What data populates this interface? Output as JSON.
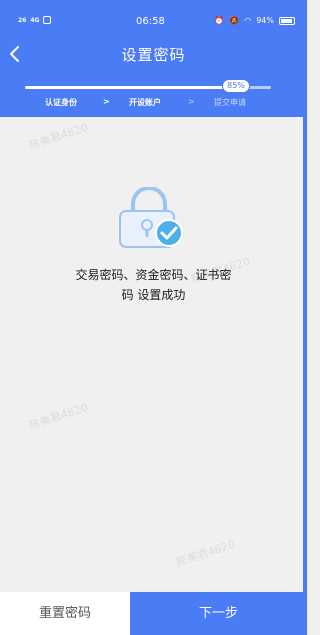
{
  "status_bar": {
    "signal_1": "26",
    "signal_2": "4G",
    "time": "06:58",
    "battery": "94%"
  },
  "nav": {
    "title": "设置密码"
  },
  "progress": {
    "value": 0.85,
    "label": "85%"
  },
  "steps": [
    {
      "label": "认证身份",
      "state": "done"
    },
    {
      "label": "开设账户",
      "state": "done"
    },
    {
      "label": "提交申请",
      "state": "pending"
    }
  ],
  "separators": [
    ">",
    ">"
  ],
  "message": {
    "line1": "交易密码、资金密码、证书密",
    "line2": "码 设置成功"
  },
  "watermark": "陈美君4620",
  "buttons": {
    "reset": "重置密码",
    "next": "下一步"
  },
  "colors": {
    "primary": "#4a7cf6",
    "check": "#4db0e8"
  }
}
